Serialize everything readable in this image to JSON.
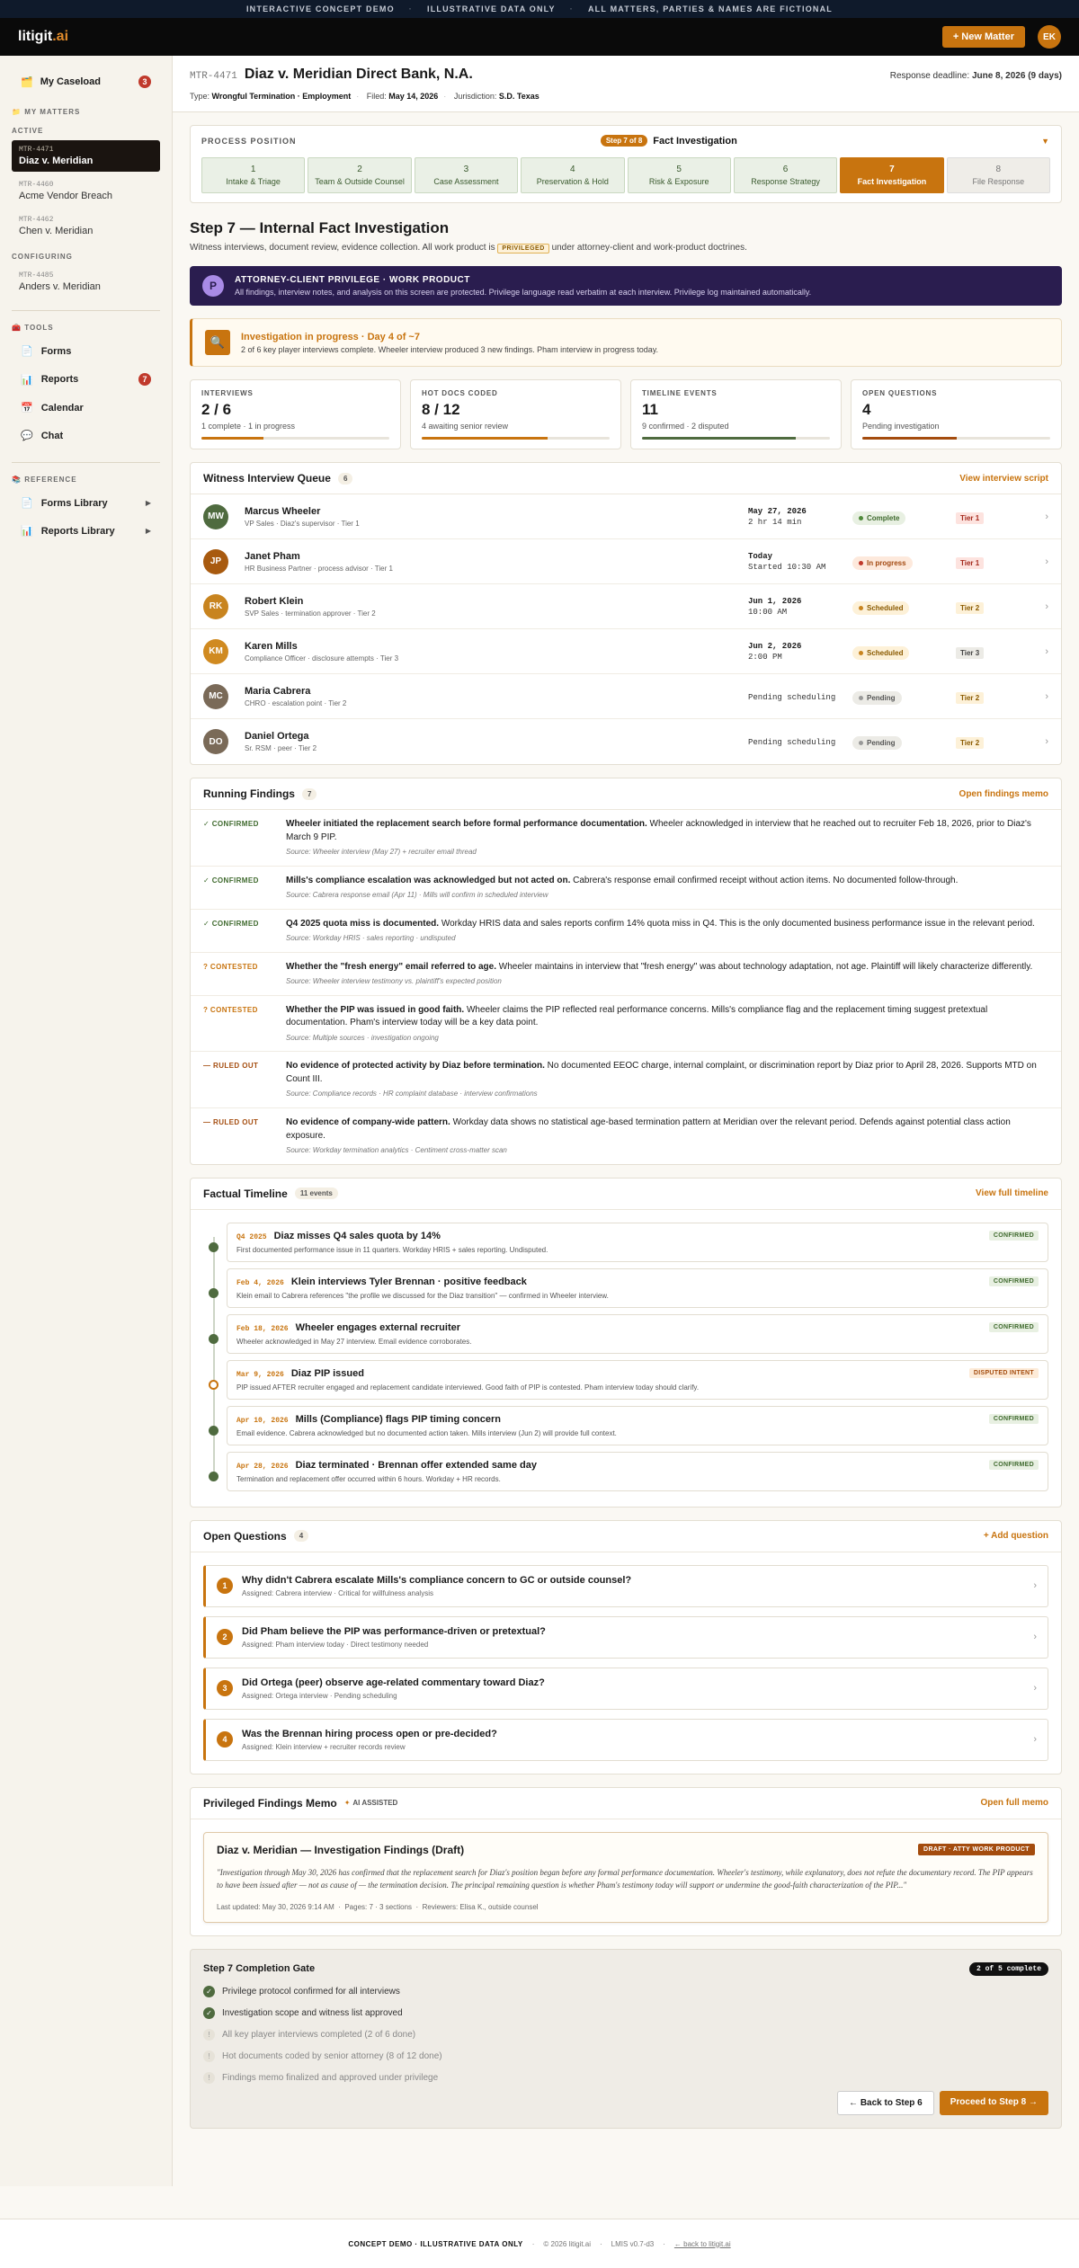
{
  "banner": [
    "INTERACTIVE CONCEPT DEMO",
    "ILLUSTRATIVE DATA ONLY",
    "ALL MATTERS, PARTIES & NAMES ARE FICTIONAL"
  ],
  "app": {
    "logo_main": "litigit",
    "logo_suffix": ".ai",
    "new_matter": "+ New Matter",
    "avatar": "EK"
  },
  "sidebar": {
    "caseload": {
      "label": "My Caseload",
      "count": "3"
    },
    "my_matters": "MY MATTERS",
    "active_label": "ACTIVE",
    "active": [
      {
        "id": "MTR-4471",
        "name": "Diaz v. Meridian"
      },
      {
        "id": "MTR-4460",
        "name": "Acme Vendor Breach"
      },
      {
        "id": "MTR-4462",
        "name": "Chen v. Meridian"
      }
    ],
    "configuring_label": "CONFIGURING",
    "configuring": [
      {
        "id": "MTR-4485",
        "name": "Anders v. Meridian"
      }
    ],
    "tools_label": "TOOLS",
    "tools": [
      {
        "label": "Forms"
      },
      {
        "label": "Reports",
        "count": "7"
      },
      {
        "label": "Calendar"
      },
      {
        "label": "Chat"
      }
    ],
    "reference_label": "REFERENCE",
    "reference": [
      {
        "label": "Forms Library"
      },
      {
        "label": "Reports Library"
      }
    ]
  },
  "matter": {
    "id": "MTR-4471",
    "title": "Diaz v. Meridian Direct Bank, N.A.",
    "deadline_label": "Response deadline:",
    "deadline": "June 8, 2026 (9 days)",
    "type_label": "Type:",
    "type": "Wrongful Termination · Employment",
    "filed_label": "Filed:",
    "filed": "May 14, 2026",
    "jur_label": "Jurisdiction:",
    "jur": "S.D. Texas"
  },
  "process": {
    "label": "PROCESS POSITION",
    "badge": "Step 7 of 8",
    "current": "Fact Investigation",
    "steps": [
      {
        "n": "1",
        "l": "Intake & Triage"
      },
      {
        "n": "2",
        "l": "Team & Outside Counsel"
      },
      {
        "n": "3",
        "l": "Case Assessment"
      },
      {
        "n": "4",
        "l": "Preservation & Hold"
      },
      {
        "n": "5",
        "l": "Risk & Exposure"
      },
      {
        "n": "6",
        "l": "Response Strategy"
      },
      {
        "n": "7",
        "l": "Fact Investigation"
      },
      {
        "n": "8",
        "l": "File Response"
      }
    ]
  },
  "step": {
    "title": "Step 7 — Internal Fact Investigation",
    "intro_a": "Witness interviews, document review, evidence collection. All work product is",
    "intro_badge": "PRIVILEGED",
    "intro_b": "under attorney-client and work-product doctrines."
  },
  "priv": {
    "icon": "P",
    "title": "ATTORNEY-CLIENT PRIVILEGE · WORK PRODUCT",
    "desc": "All findings, interview notes, and analysis on this screen are protected. Privilege language read verbatim at each interview. Privilege log maintained automatically."
  },
  "progress": {
    "title": "Investigation in progress · Day 4 of ~7",
    "desc": "2 of 6 key player interviews complete. Wheeler interview produced 3 new findings. Pham interview in progress today."
  },
  "stats": [
    {
      "label": "INTERVIEWS",
      "value": "2 / 6",
      "sub": "1 complete · 1 in progress",
      "pct": 0.33,
      "color": "#c8740f"
    },
    {
      "label": "HOT DOCS CODED",
      "value": "8 / 12",
      "sub": "4 awaiting senior review",
      "pct": 0.67,
      "color": "#c8740f"
    },
    {
      "label": "TIMELINE EVENTS",
      "value": "11",
      "sub": "9 confirmed · 2 disputed",
      "pct": 0.82,
      "color": "#4f6b3f"
    },
    {
      "label": "OPEN QUESTIONS",
      "value": "4",
      "sub": "Pending investigation",
      "pct": 0.5,
      "color": "#a44c0e"
    }
  ],
  "witness": {
    "title": "Witness Interview Queue",
    "count": "6",
    "link": "View interview script",
    "rows": [
      {
        "ini": "MW",
        "color": "#4f6b3f",
        "name": "Marcus Wheeler",
        "role": "VP Sales · Diaz's supervisor · Tier 1",
        "d1": "May 27, 2026",
        "d2": "2 hr 14 min",
        "status": "Complete",
        "tier": "Tier 1"
      },
      {
        "ini": "JP",
        "color": "#a85a0f",
        "name": "Janet Pham",
        "role": "HR Business Partner · process advisor · Tier 1",
        "d1": "Today",
        "d2": "Started 10:30 AM",
        "status": "In progress",
        "tier": "Tier 1"
      },
      {
        "ini": "RK",
        "color": "#c8841f",
        "name": "Robert Klein",
        "role": "SVP Sales · termination approver · Tier 2",
        "d1": "Jun 1, 2026",
        "d2": "10:00 AM",
        "status": "Scheduled",
        "tier": "Tier 2"
      },
      {
        "ini": "KM",
        "color": "#d08a20",
        "name": "Karen Mills",
        "role": "Compliance Officer · disclosure attempts · Tier 3",
        "d1": "Jun 2, 2026",
        "d2": "2:00 PM",
        "status": "Scheduled",
        "tier": "Tier 3"
      },
      {
        "ini": "MC",
        "color": "#7a6a58",
        "name": "Maria Cabrera",
        "role": "CHRO · escalation point · Tier 2",
        "d1": "",
        "d2": "Pending scheduling",
        "status": "Pending",
        "tier": "Tier 2"
      },
      {
        "ini": "DO",
        "color": "#7a6a58",
        "name": "Daniel Ortega",
        "role": "Sr. RSM · peer · Tier 2",
        "d1": "",
        "d2": "Pending scheduling",
        "status": "Pending",
        "tier": "Tier 2"
      }
    ]
  },
  "findings": {
    "title": "Running Findings",
    "count": "7",
    "link": "Open findings memo",
    "rows": [
      {
        "tag": "✓ CONFIRMED",
        "kind": "c",
        "bold": "Wheeler initiated the replacement search before formal performance documentation.",
        "text": " Wheeler acknowledged in interview that he reached out to recruiter Feb 18, 2026, prior to Diaz's March 9 PIP.",
        "src": "Source: Wheeler interview (May 27) + recruiter email thread"
      },
      {
        "tag": "✓ CONFIRMED",
        "kind": "c",
        "bold": "Mills's compliance escalation was acknowledged but not acted on.",
        "text": " Cabrera's response email confirmed receipt without action items. No documented follow-through.",
        "src": "Source: Cabrera response email (Apr 11) · Mills will confirm in scheduled interview"
      },
      {
        "tag": "✓ CONFIRMED",
        "kind": "c",
        "bold": "Q4 2025 quota miss is documented.",
        "text": " Workday HRIS data and sales reports confirm 14% quota miss in Q4. This is the only documented business performance issue in the relevant period.",
        "src": "Source: Workday HRIS · sales reporting · undisputed"
      },
      {
        "tag": "? CONTESTED",
        "kind": "q",
        "bold": "Whether the \"fresh energy\" email referred to age.",
        "text": " Wheeler maintains in interview that \"fresh energy\" was about technology adaptation, not age. Plaintiff will likely characterize differently.",
        "src": "Source: Wheeler interview testimony vs. plaintiff's expected position"
      },
      {
        "tag": "? CONTESTED",
        "kind": "q",
        "bold": "Whether the PIP was issued in good faith.",
        "text": " Wheeler claims the PIP reflected real performance concerns. Mills's compliance flag and the replacement timing suggest pretextual documentation. Pham's interview today will be a key data point.",
        "src": "Source: Multiple sources · investigation ongoing"
      },
      {
        "tag": "— RULED OUT",
        "kind": "r",
        "bold": "No evidence of protected activity by Diaz before termination.",
        "text": " No documented EEOC charge, internal complaint, or discrimination report by Diaz prior to April 28, 2026. Supports MTD on Count III.",
        "src": "Source: Compliance records · HR complaint database · interview confirmations"
      },
      {
        "tag": "— RULED OUT",
        "kind": "r",
        "bold": "No evidence of company-wide pattern.",
        "text": " Workday data shows no statistical age-based termination pattern at Meridian over the relevant period. Defends against potential class action exposure.",
        "src": "Source: Workday termination analytics · Centiment cross-matter scan"
      }
    ]
  },
  "timeline": {
    "title": "Factual Timeline",
    "count": "11 events",
    "link": "View full timeline",
    "rows": [
      {
        "date": "Q4 2025",
        "title": "Diaz misses Q4 sales quota by 14%",
        "desc": "First documented performance issue in 11 quarters. Workday HRIS + sales reporting. Undisputed.",
        "status": "CONFIRMED",
        "disputed": false
      },
      {
        "date": "Feb 4, 2026",
        "title": "Klein interviews Tyler Brennan · positive feedback",
        "desc": "Klein email to Cabrera references \"the profile we discussed for the Diaz transition\" — confirmed in Wheeler interview.",
        "status": "CONFIRMED",
        "disputed": false
      },
      {
        "date": "Feb 18, 2026",
        "title": "Wheeler engages external recruiter",
        "desc": "Wheeler acknowledged in May 27 interview. Email evidence corroborates.",
        "status": "CONFIRMED",
        "disputed": false
      },
      {
        "date": "Mar 9, 2026",
        "title": "Diaz PIP issued",
        "desc": "PIP issued AFTER recruiter engaged and replacement candidate interviewed. Good faith of PIP is contested. Pham interview today should clarify.",
        "status": "DISPUTED INTENT",
        "disputed": true
      },
      {
        "date": "Apr 10, 2026",
        "title": "Mills (Compliance) flags PIP timing concern",
        "desc": "Email evidence. Cabrera acknowledged but no documented action taken. Mills interview (Jun 2) will provide full context.",
        "status": "CONFIRMED",
        "disputed": false
      },
      {
        "date": "Apr 28, 2026",
        "title": "Diaz terminated · Brennan offer extended same day",
        "desc": "Termination and replacement offer occurred within 6 hours. Workday + HR records.",
        "status": "CONFIRMED",
        "disputed": false
      }
    ]
  },
  "questions": {
    "title": "Open Questions",
    "count": "4",
    "link": "+ Add question",
    "rows": [
      {
        "n": "1",
        "q": "Why didn't Cabrera escalate Mills's compliance concern to GC or outside counsel?",
        "a": "Assigned: Cabrera interview · Critical for willfulness analysis"
      },
      {
        "n": "2",
        "q": "Did Pham believe the PIP was performance-driven or pretextual?",
        "a": "Assigned: Pham interview today · Direct testimony needed"
      },
      {
        "n": "3",
        "q": "Did Ortega (peer) observe age-related commentary toward Diaz?",
        "a": "Assigned: Ortega interview · Pending scheduling"
      },
      {
        "n": "4",
        "q": "Was the Brennan hiring process open or pre-decided?",
        "a": "Assigned: Klein interview + recruiter records review"
      }
    ]
  },
  "memo": {
    "title": "Privileged Findings Memo",
    "ai": "AI ASSISTED",
    "link": "Open full memo",
    "doc_title": "Diaz v. Meridian — Investigation Findings (Draft)",
    "draft": "DRAFT · ATTY WORK PRODUCT",
    "body": "\"Investigation through May 30, 2026 has confirmed that the replacement search for Diaz's position began before any formal performance documentation. Wheeler's testimony, while explanatory, does not refute the documentary record. The PIP appears to have been issued after — not as cause of — the termination decision. The principal remaining question is whether Pham's testimony today will support or undermine the good-faith characterization of the PIP...\"",
    "updated": "Last updated: May 30, 2026 9:14 AM",
    "pages": "Pages: 7 · 3 sections",
    "reviewers": "Reviewers: Elisa K., outside counsel"
  },
  "gate": {
    "title": "Step 7 Completion Gate",
    "count": "2 of 5 complete",
    "items": [
      {
        "t": "Privilege protocol confirmed for all interviews",
        "done": true
      },
      {
        "t": "Investigation scope and witness list approved",
        "done": true
      },
      {
        "t": "All key player interviews completed (2 of 6 done)",
        "done": false
      },
      {
        "t": "Hot documents coded by senior attorney (8 of 12 done)",
        "done": false
      },
      {
        "t": "Findings memo finalized and approved under privilege",
        "done": false
      }
    ],
    "back": "← Back to Step 6",
    "next": "Proceed to Step 8 →"
  },
  "footer": {
    "a": "CONCEPT DEMO · ILLUSTRATIVE DATA ONLY",
    "b": "© 2026 litigit.ai",
    "c": "LMIS v0.7-d3",
    "d": "← back to litigit.ai"
  }
}
